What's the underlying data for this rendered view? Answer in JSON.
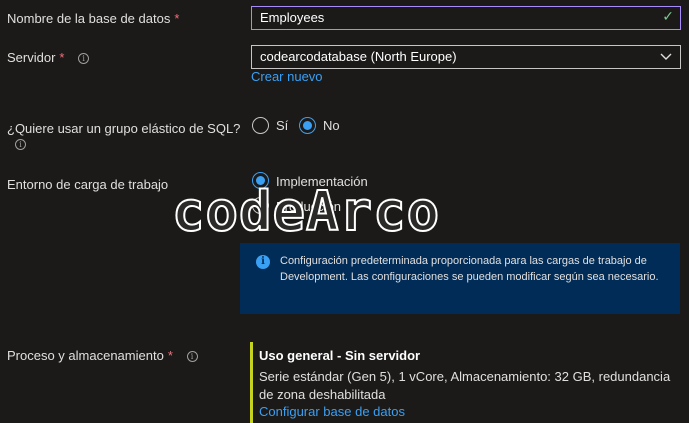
{
  "db_name": {
    "label": "Nombre de la base de datos",
    "required": "*",
    "value": "Employees",
    "check_icon": "check-icon"
  },
  "server": {
    "label": "Servidor",
    "required": "*",
    "value": "codearcodatabase (North Europe)",
    "create_new": "Crear nuevo",
    "chevron_icon": "chevron-down-icon"
  },
  "elastic_pool": {
    "label": "¿Quiere usar un grupo elástico de SQL?",
    "options": [
      {
        "label": "Sí",
        "selected": false
      },
      {
        "label": "No",
        "selected": true
      }
    ]
  },
  "workload": {
    "label": "Entorno de carga de trabajo",
    "options": [
      {
        "label": "Implementación",
        "selected": true
      },
      {
        "label": "Producción",
        "selected": false
      }
    ],
    "info": "Configuración predeterminada proporcionada para las cargas de trabajo de Development. Las configuraciones se pueden modificar según sea necesario."
  },
  "compute": {
    "label": "Proceso y almacenamiento",
    "required": "*",
    "tier_title": "Uso general - Sin servidor",
    "tier_desc": "Serie estándar (Gen 5), 1 vCore, Almacenamiento: 32 GB, redundancia de zona deshabilitada",
    "configure_link": "Configurar base de datos"
  },
  "watermark": "codeArco",
  "colors": {
    "background": "#1b1a19",
    "accent": "#3aa0f3",
    "required": "#f1707b",
    "focus_border": "#a78bfa",
    "tier_bar": "#c5d21e",
    "info_bg": "#002c57"
  }
}
